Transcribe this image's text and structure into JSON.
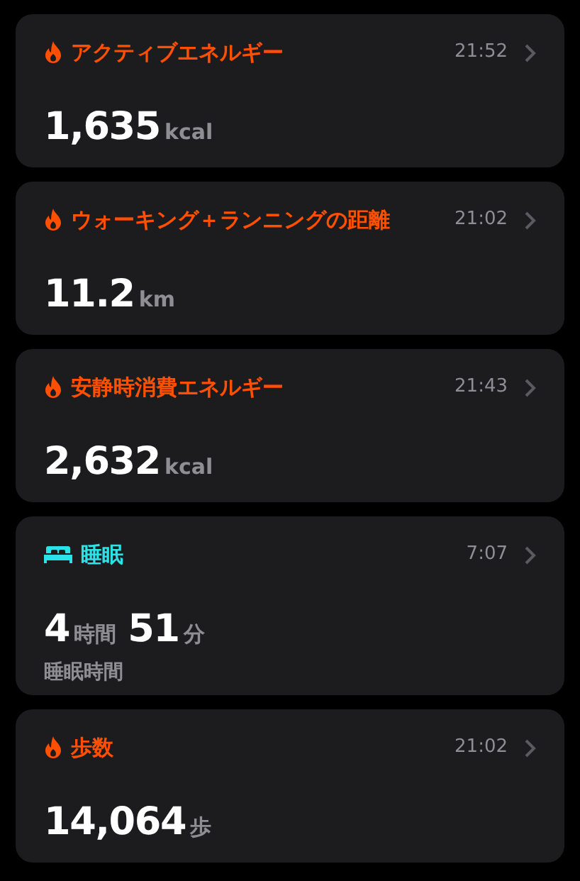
{
  "cards": [
    {
      "kind": "activity",
      "color": "#ff4f00",
      "title": "アクティブエネルギー",
      "time": "21:52",
      "values": [
        {
          "number": "1,635",
          "unit": "kcal"
        }
      ]
    },
    {
      "kind": "activity",
      "color": "#ff4f00",
      "title": "ウォーキング＋ランニングの距離",
      "time": "21:02",
      "values": [
        {
          "number": "11.2",
          "unit": "km"
        }
      ]
    },
    {
      "kind": "activity",
      "color": "#ff4f00",
      "title": "安静時消費エネルギー",
      "time": "21:43",
      "values": [
        {
          "number": "2,632",
          "unit": "kcal"
        }
      ]
    },
    {
      "kind": "sleep",
      "color": "#2de2e6",
      "title": "睡眠",
      "time": "7:07",
      "values": [
        {
          "number": "4",
          "unit": "時間"
        },
        {
          "number": "51",
          "unit": "分"
        }
      ],
      "subtitle": "睡眠時間"
    },
    {
      "kind": "activity",
      "color": "#ff4f00",
      "title": "歩数",
      "time": "21:02",
      "values": [
        {
          "number": "14,064",
          "unit": "歩"
        }
      ]
    }
  ]
}
